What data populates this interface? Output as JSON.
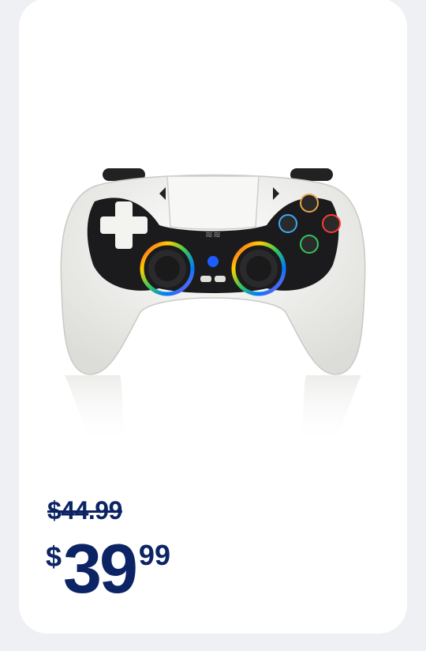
{
  "product": {
    "image_alt": "white wireless game controller with RGB light rings",
    "colors": {
      "controller_body": "#f2f2f0",
      "face_panel": "#1b1b1d",
      "price_text": "#0c2464",
      "background": "#eef0f4"
    }
  },
  "pricing": {
    "original_price": "$44.99",
    "currency_symbol": "$",
    "sale_dollars": "39",
    "sale_cents": "99"
  }
}
